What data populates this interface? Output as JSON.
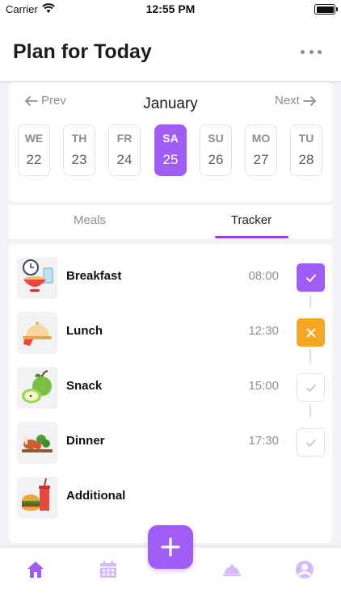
{
  "status_bar": {
    "carrier": "Carrier",
    "time": "12:55 PM"
  },
  "header": {
    "title": "Plan for Today"
  },
  "calendar": {
    "prev_label": "Prev",
    "next_label": "Next",
    "month": "January",
    "days": [
      {
        "name": "WE",
        "date": "22",
        "selected": false
      },
      {
        "name": "TH",
        "date": "23",
        "selected": false
      },
      {
        "name": "FR",
        "date": "24",
        "selected": false
      },
      {
        "name": "SA",
        "date": "25",
        "selected": true
      },
      {
        "name": "SU",
        "date": "26",
        "selected": false
      },
      {
        "name": "MO",
        "date": "27",
        "selected": false
      },
      {
        "name": "TU",
        "date": "28",
        "selected": false
      }
    ]
  },
  "tabs": {
    "meals": "Meals",
    "tracker": "Tracker",
    "active": "tracker"
  },
  "meals": [
    {
      "name": "Breakfast",
      "time": "08:00",
      "status": "done"
    },
    {
      "name": "Lunch",
      "time": "12:30",
      "status": "skipped"
    },
    {
      "name": "Snack",
      "time": "15:00",
      "status": "pending"
    },
    {
      "name": "Dinner",
      "time": "17:30",
      "status": "pending"
    },
    {
      "name": "Additional",
      "time": "",
      "status": "none"
    }
  ],
  "tab_bar": {
    "items": [
      "home-icon",
      "calendar-icon",
      "add-icon",
      "cloche-icon",
      "profile-icon"
    ],
    "active": "home-icon"
  },
  "colors": {
    "accent": "#a05cf5",
    "skip": "#f5a623",
    "inactive": "#d7b8fb"
  }
}
